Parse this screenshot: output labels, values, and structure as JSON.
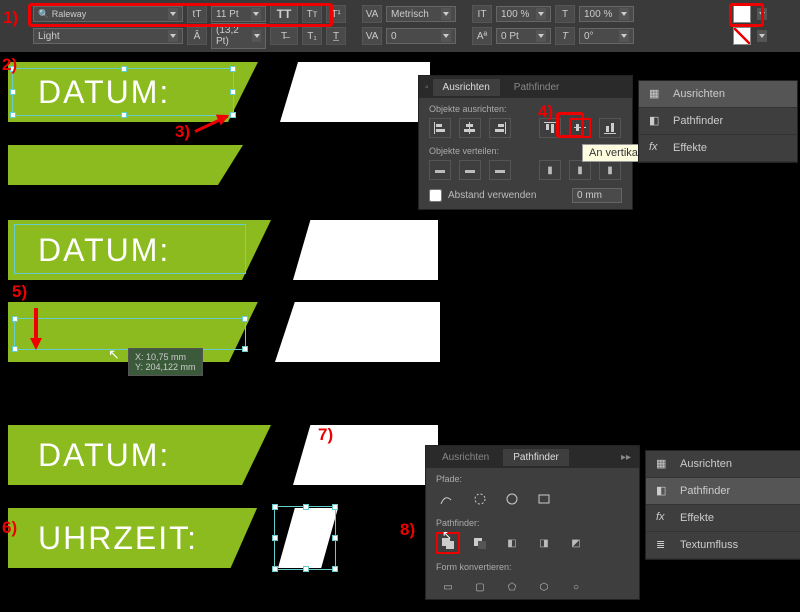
{
  "toolbar": {
    "font": "Raleway",
    "weight": "Light",
    "size": "11 Pt",
    "leading": "(13,2 Pt)",
    "tracking_mode": "Metrisch",
    "scale_x": "100 %",
    "scale_y": "100 %",
    "baseline": "0 Pt",
    "skew": "0°",
    "swatch_color": "#ffffff"
  },
  "annotations": {
    "n1": "1)",
    "n2": "2)",
    "n3": "3)",
    "n4": "4)",
    "n5": "5)",
    "n6": "6)",
    "n7": "7)",
    "n8": "8)"
  },
  "blocks": {
    "datum": "DATUM:",
    "uhrzeit": "UHRZEIT:"
  },
  "coord_tip": {
    "x": "X: 10,75 mm",
    "y": "Y: 204,122 mm"
  },
  "align_panel": {
    "tab1": "Ausrichten",
    "tab2": "Pathfinder",
    "sect1": "Objekte ausrichten:",
    "sect2": "Objekte verteilen:",
    "abstand_label": "Abstand verwenden",
    "abstand_val": "0 mm",
    "tooltip": "An vertikaler Mittelachse ausricht"
  },
  "side1": {
    "i1": "Ausrichten",
    "i2": "Pathfinder",
    "i3": "Effekte"
  },
  "pf_panel": {
    "tab1": "Ausrichten",
    "tab2": "Pathfinder",
    "s1": "Pfade:",
    "s2": "Pathfinder:",
    "s3": "Form konvertieren:"
  },
  "side2": {
    "i1": "Ausrichten",
    "i2": "Pathfinder",
    "i3": "Effekte",
    "i4": "Textumfluss"
  }
}
